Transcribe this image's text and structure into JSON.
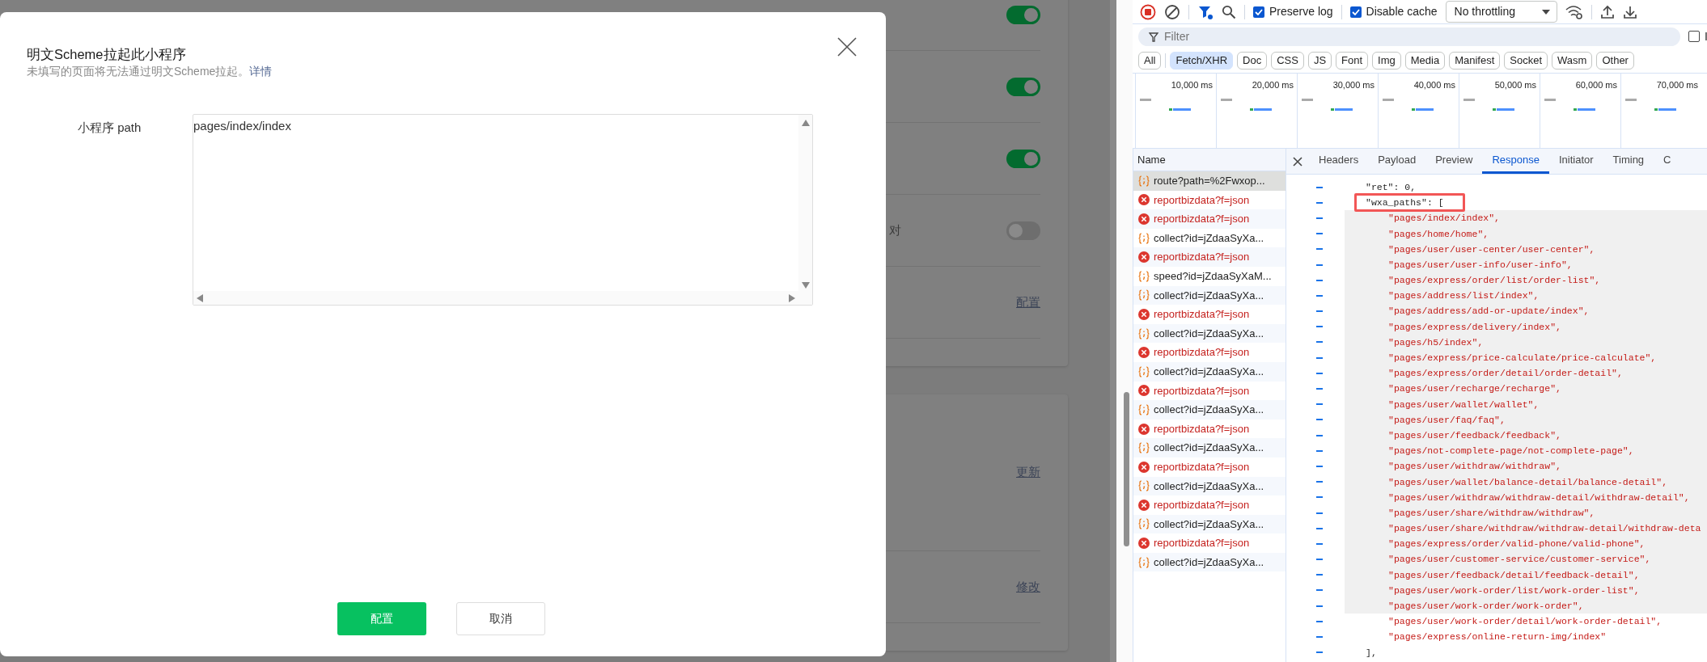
{
  "page": {
    "cards": [
      {
        "rows": [
          {
            "kind": "toggle",
            "on": true
          },
          {
            "kind": "toggle",
            "on": true
          },
          {
            "kind": "toggle",
            "on": true
          },
          {
            "kind": "toggle",
            "on": false,
            "label": "对"
          },
          {
            "kind": "action",
            "action": "配置"
          }
        ]
      },
      {
        "rows": [
          {
            "kind": "action",
            "action": "更新",
            "tall": true
          },
          {
            "kind": "action",
            "action": "修改"
          }
        ]
      }
    ]
  },
  "modal": {
    "title": "明文Scheme拉起此小程序",
    "subtitle": "未填写的页面将无法通过明文Scheme拉起。",
    "subtitle_link": "详情",
    "field_label": "小程序 path",
    "field_value": "pages/index/index",
    "buttons": [
      {
        "label": "配置",
        "kind": "primary"
      },
      {
        "label": "取消",
        "kind": "default"
      }
    ]
  },
  "devtools": {
    "toolbar": {
      "checkboxes": [
        {
          "label": "Preserve log",
          "checked": true
        },
        {
          "label": "Disable cache",
          "checked": true
        }
      ],
      "throttling": "No throttling"
    },
    "filter": {
      "placeholder": "Filter",
      "checkbox": {
        "label": "I",
        "checked": false
      }
    },
    "types": [
      {
        "label": "All",
        "selected": false
      },
      {
        "label": "Fetch/XHR",
        "selected": true
      },
      {
        "label": "Doc",
        "selected": false
      },
      {
        "label": "CSS",
        "selected": false
      },
      {
        "label": "JS",
        "selected": false
      },
      {
        "label": "Font",
        "selected": false
      },
      {
        "label": "Img",
        "selected": false
      },
      {
        "label": "Media",
        "selected": false
      },
      {
        "label": "Manifest",
        "selected": false
      },
      {
        "label": "Socket",
        "selected": false
      },
      {
        "label": "Wasm",
        "selected": false
      },
      {
        "label": "Other",
        "selected": false
      }
    ],
    "timeline_ticks": [
      "10,000 ms",
      "20,000 ms",
      "30,000 ms",
      "40,000 ms",
      "50,000 ms",
      "60,000 ms",
      "70,000 ms"
    ],
    "requests": {
      "column": "Name",
      "rows": [
        {
          "name": "route?path=%2Fwxop...",
          "error": false,
          "selected": true
        },
        {
          "name": "reportbizdata?f=json",
          "error": true,
          "selected": false
        },
        {
          "name": "reportbizdata?f=json",
          "error": true,
          "selected": false
        },
        {
          "name": "collect?id=jZdaaSyXa...",
          "error": false,
          "selected": false
        },
        {
          "name": "reportbizdata?f=json",
          "error": true,
          "selected": false
        },
        {
          "name": "speed?id=jZdaaSyXaM...",
          "error": false,
          "selected": false
        },
        {
          "name": "collect?id=jZdaaSyXa...",
          "error": false,
          "selected": false
        },
        {
          "name": "reportbizdata?f=json",
          "error": true,
          "selected": false
        },
        {
          "name": "collect?id=jZdaaSyXa...",
          "error": false,
          "selected": false
        },
        {
          "name": "reportbizdata?f=json",
          "error": true,
          "selected": false
        },
        {
          "name": "collect?id=jZdaaSyXa...",
          "error": false,
          "selected": false
        },
        {
          "name": "reportbizdata?f=json",
          "error": true,
          "selected": false
        },
        {
          "name": "collect?id=jZdaaSyXa...",
          "error": false,
          "selected": false
        },
        {
          "name": "reportbizdata?f=json",
          "error": true,
          "selected": false
        },
        {
          "name": "collect?id=jZdaaSyXa...",
          "error": false,
          "selected": false
        },
        {
          "name": "reportbizdata?f=json",
          "error": true,
          "selected": false
        },
        {
          "name": "collect?id=jZdaaSyXa...",
          "error": false,
          "selected": false
        },
        {
          "name": "reportbizdata?f=json",
          "error": true,
          "selected": false
        },
        {
          "name": "collect?id=jZdaaSyXa...",
          "error": false,
          "selected": false
        },
        {
          "name": "reportbizdata?f=json",
          "error": true,
          "selected": false
        },
        {
          "name": "collect?id=jZdaaSyXa...",
          "error": false,
          "selected": false
        }
      ]
    },
    "detail_tabs": [
      {
        "label": "Headers",
        "selected": false
      },
      {
        "label": "Payload",
        "selected": false
      },
      {
        "label": "Preview",
        "selected": false
      },
      {
        "label": "Response",
        "selected": true
      },
      {
        "label": "Initiator",
        "selected": false
      },
      {
        "label": "Timing",
        "selected": false
      },
      {
        "label": "C",
        "selected": false
      }
    ],
    "response": {
      "lines": [
        {
          "text": "\"ret\": 0,",
          "highlighted": false,
          "framed": false
        },
        {
          "text": "\"wxa_paths\": [",
          "highlighted": false,
          "framed": true,
          "children": [
            {
              "text": "\"pages/index/index\",",
              "highlighted": true
            },
            {
              "text": "\"pages/home/home\",",
              "highlighted": true
            },
            {
              "text": "\"pages/user/user-center/user-center\",",
              "highlighted": true
            },
            {
              "text": "\"pages/user/user-info/user-info\",",
              "highlighted": true
            },
            {
              "text": "\"pages/express/order/list/order-list\",",
              "highlighted": true
            },
            {
              "text": "\"pages/address/list/index\",",
              "highlighted": true
            },
            {
              "text": "\"pages/address/add-or-update/index\",",
              "highlighted": true
            },
            {
              "text": "\"pages/express/delivery/index\",",
              "highlighted": true
            },
            {
              "text": "\"pages/h5/index\",",
              "highlighted": true
            },
            {
              "text": "\"pages/express/price-calculate/price-calculate\",",
              "highlighted": true
            },
            {
              "text": "\"pages/express/order/detail/order-detail\",",
              "highlighted": true
            },
            {
              "text": "\"pages/user/recharge/recharge\",",
              "highlighted": true
            },
            {
              "text": "\"pages/user/wallet/wallet\",",
              "highlighted": true
            },
            {
              "text": "\"pages/user/faq/faq\",",
              "highlighted": true
            },
            {
              "text": "\"pages/user/feedback/feedback\",",
              "highlighted": true
            },
            {
              "text": "\"pages/not-complete-page/not-complete-page\",",
              "highlighted": true
            },
            {
              "text": "\"pages/user/withdraw/withdraw\",",
              "highlighted": true
            },
            {
              "text": "\"pages/user/wallet/balance-detail/balance-detail\",",
              "highlighted": true
            },
            {
              "text": "\"pages/user/withdraw/withdraw-detail/withdraw-detail\",",
              "highlighted": true
            },
            {
              "text": "\"pages/user/share/withdraw/withdraw\",",
              "highlighted": true
            },
            {
              "text": "\"pages/user/share/withdraw/withdraw-detail/withdraw-deta",
              "highlighted": true
            },
            {
              "text": "\"pages/express/order/valid-phone/valid-phone\",",
              "highlighted": true
            },
            {
              "text": "\"pages/user/customer-service/customer-service\",",
              "highlighted": true
            },
            {
              "text": "\"pages/user/feedback/detail/feedback-detail\",",
              "highlighted": true
            },
            {
              "text": "\"pages/user/work-order/list/work-order-list\",",
              "highlighted": true
            },
            {
              "text": "\"pages/user/work-order/work-order\",",
              "highlighted": true
            },
            {
              "text": "\"pages/user/work-order/detail/work-order-detail\",",
              "highlighted": false
            },
            {
              "text": "\"pages/express/online-return-img/index\"",
              "highlighted": false
            }
          ]
        },
        {
          "text": "],",
          "highlighted": false,
          "framed": false
        }
      ]
    }
  }
}
